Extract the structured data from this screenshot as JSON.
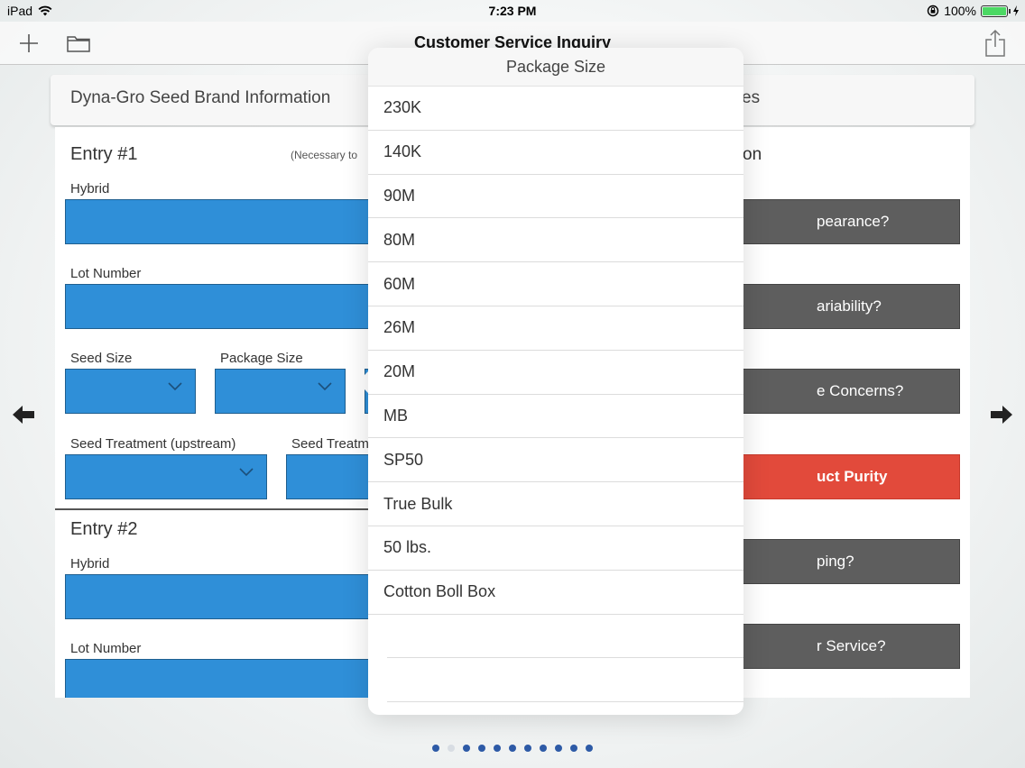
{
  "status_bar": {
    "device": "iPad",
    "time": "7:23 PM",
    "battery": "100%",
    "battery_level": 1.0
  },
  "toolbar": {
    "title": "Customer Service Inquiry",
    "icons": [
      "plus-icon",
      "folder-icon",
      "share-icon"
    ]
  },
  "section_header": {
    "left": "Dyna-Gro Seed Brand Information",
    "right": "es"
  },
  "left_panel": {
    "entry1": {
      "title": "Entry #1",
      "note": "(Necessary to",
      "hybrid_label": "Hybrid",
      "lot_label": "Lot Number",
      "seed_size_label": "Seed Size",
      "package_size_label": "Package Size",
      "seed_treatment_label": "Seed Treatment (upstream)",
      "seed_treatment2_label": "Seed Treatm"
    },
    "entry2": {
      "title": "Entry #2",
      "hybrid_label": "Hybrid",
      "lot_label": "Lot Number"
    }
  },
  "right_panel": {
    "heading": "on",
    "buttons": [
      {
        "label": "pearance?",
        "selected": false
      },
      {
        "label": "ariability?",
        "selected": false
      },
      {
        "label": "e Concerns?",
        "selected": false
      },
      {
        "label": "uct Purity",
        "selected": true
      },
      {
        "label": "ping?",
        "selected": false
      },
      {
        "label": "r Service?",
        "selected": false
      }
    ]
  },
  "popover": {
    "title": "Package Size",
    "options": [
      "230K",
      "140K",
      "90M",
      "80M",
      "60M",
      "26M",
      "20M",
      "MB",
      "SP50",
      "True Bulk",
      "50 lbs.",
      "Cotton Boll Box"
    ]
  },
  "navigation": {
    "icons": [
      "arrow-left-icon",
      "arrow-right-icon"
    ],
    "page_count": 11,
    "current_page": 2
  },
  "colors": {
    "field_blue": "#2f8fd8",
    "button_gray": "#5e5e5e",
    "selected_red": "#e24a3b",
    "page_dot_active": "#2d5aa6"
  }
}
